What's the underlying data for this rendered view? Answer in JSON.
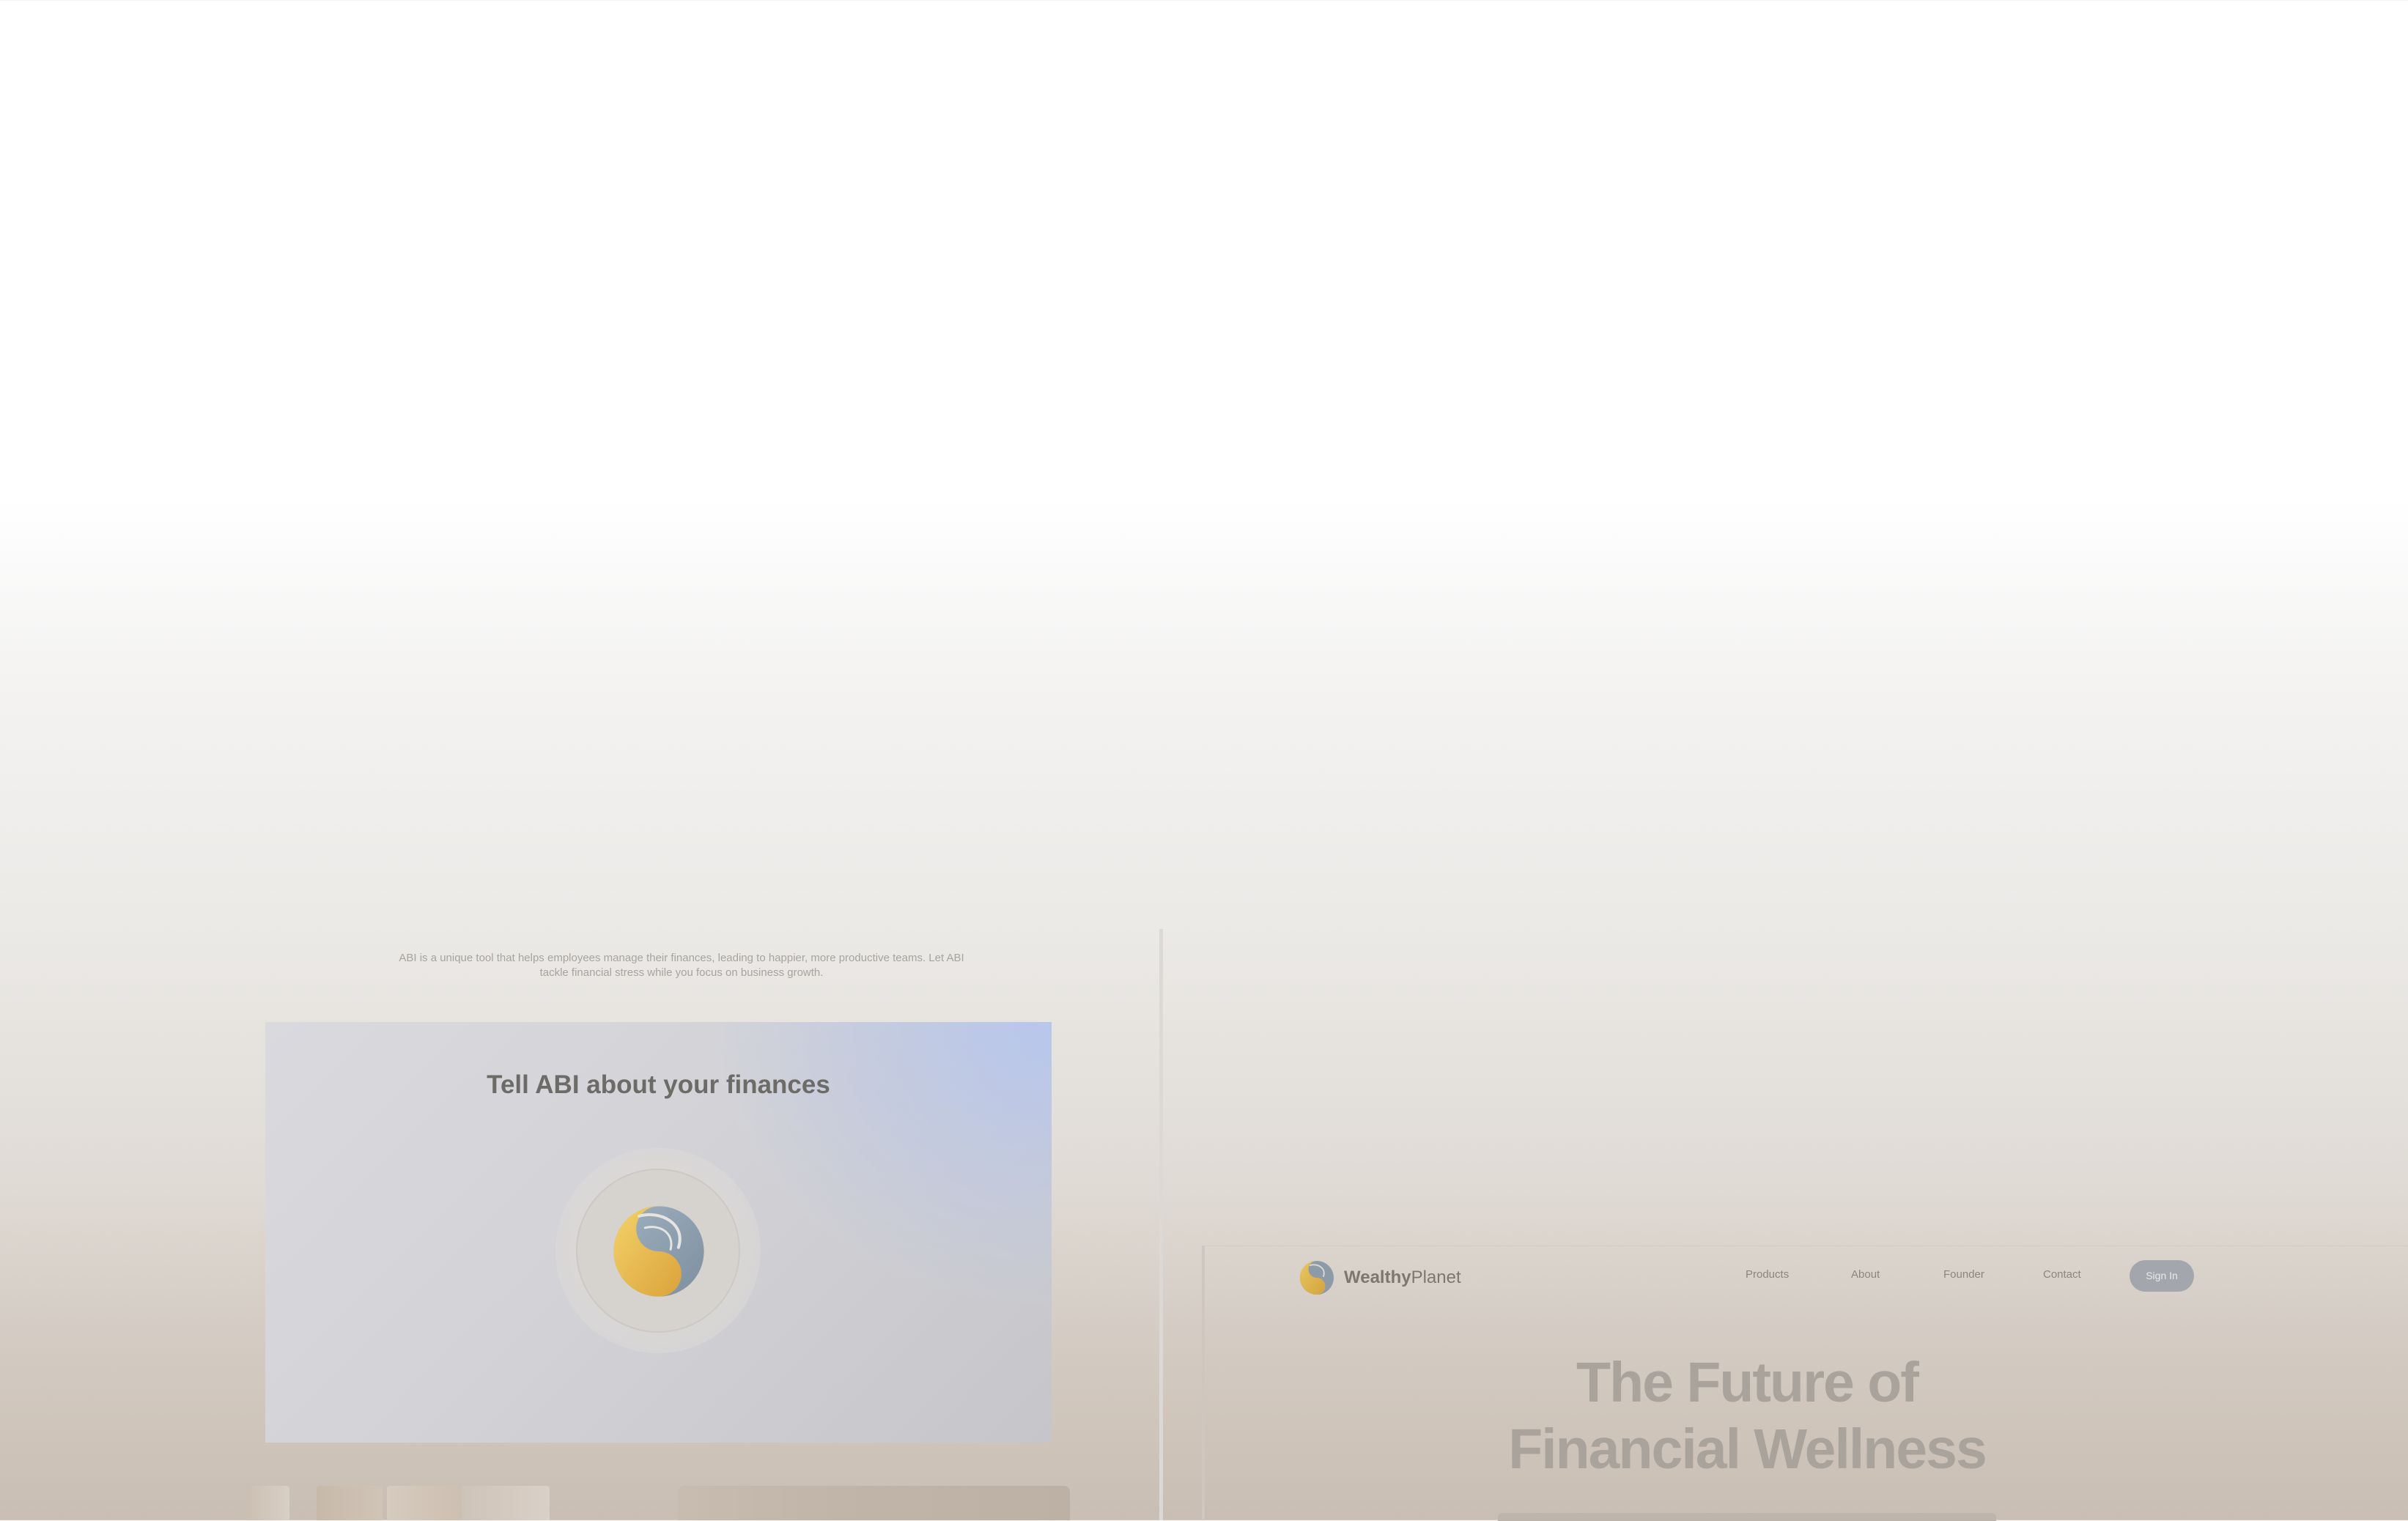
{
  "left": {
    "tagline": "ABI is a unique tool that helps employees manage their finances, leading to happier, more productive teams. Let ABI tackle financial stress while you focus on business growth.",
    "card_title": "Tell ABI about your finances",
    "logo_icon": "abi-swirl-logo"
  },
  "right": {
    "brand_strong": "Wealthy",
    "brand_light": "Planet",
    "nav": [
      "Products",
      "About",
      "Founder",
      "Contact"
    ],
    "signin_label": "Sign In",
    "hero_line1": "The Future of",
    "hero_line2": "Financial Wellness"
  },
  "colors": {
    "logo_gold": "#e9c04a",
    "logo_slate": "#8d9fb0",
    "signin_bg": "#a3a7ad",
    "hero_text": "#aaa39c",
    "card_accent": "#b6c6ee"
  }
}
